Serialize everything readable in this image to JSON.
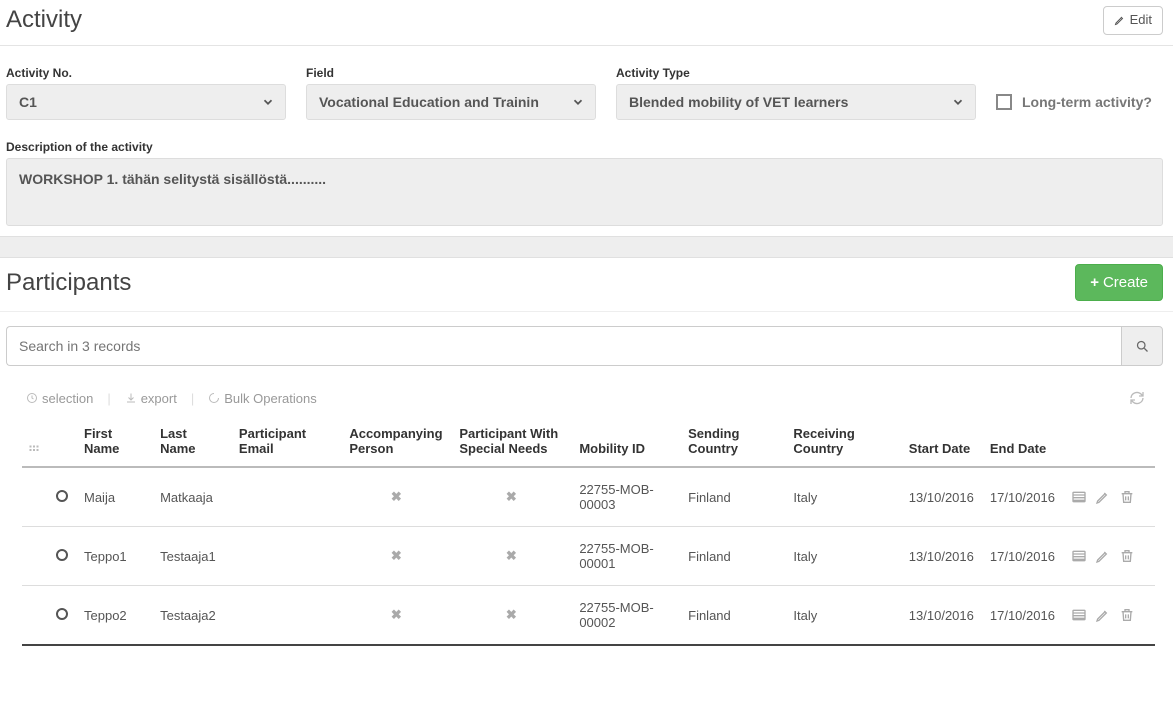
{
  "activity": {
    "title": "Activity",
    "edit_label": "Edit",
    "fields": {
      "activity_no": {
        "label": "Activity No.",
        "value": "C1"
      },
      "field": {
        "label": "Field",
        "value": "Vocational Education and Trainin"
      },
      "activity_type": {
        "label": "Activity Type",
        "value": "Blended mobility of VET learners"
      },
      "long_term": {
        "label": "Long-term activity?"
      },
      "description": {
        "label": "Description of the activity",
        "value": "WORKSHOP 1. tähän selitystä sisällöstä.........."
      }
    }
  },
  "participants": {
    "title": "Participants",
    "create_label": "Create",
    "search_placeholder": "Search in 3 records",
    "toolbar": {
      "selection_label": "selection",
      "export_label": "export",
      "bulk_label": "Bulk Operations"
    },
    "columns": {
      "first_name": "First Name",
      "last_name": "Last Name",
      "email": "Participant Email",
      "accompanying": "Accompanying Person",
      "special_needs": "Participant With Special Needs",
      "mobility_id": "Mobility ID",
      "sending": "Sending Country",
      "receiving": "Receiving Country",
      "start": "Start Date",
      "end": "End Date"
    },
    "rows": [
      {
        "first_name": "Maija",
        "last_name": "Matkaaja",
        "email": "",
        "accompanying": "✖",
        "special_needs": "✖",
        "mobility_id": "22755-MOB-00003",
        "sending": "Finland",
        "receiving": "Italy",
        "start": "13/10/2016",
        "end": "17/10/2016"
      },
      {
        "first_name": "Teppo1",
        "last_name": "Testaaja1",
        "email": "",
        "accompanying": "✖",
        "special_needs": "✖",
        "mobility_id": "22755-MOB-00001",
        "sending": "Finland",
        "receiving": "Italy",
        "start": "13/10/2016",
        "end": "17/10/2016"
      },
      {
        "first_name": "Teppo2",
        "last_name": "Testaaja2",
        "email": "",
        "accompanying": "✖",
        "special_needs": "✖",
        "mobility_id": "22755-MOB-00002",
        "sending": "Finland",
        "receiving": "Italy",
        "start": "13/10/2016",
        "end": "17/10/2016"
      }
    ]
  }
}
